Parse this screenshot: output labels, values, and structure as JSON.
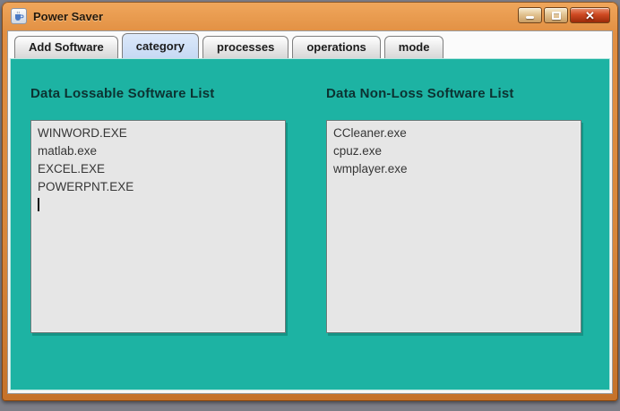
{
  "window": {
    "title": "Power Saver",
    "controls": {
      "close_glyph": "✕"
    }
  },
  "tabs": [
    {
      "label": "Add Software",
      "selected": false
    },
    {
      "label": "category",
      "selected": true
    },
    {
      "label": "processes",
      "selected": false
    },
    {
      "label": "operations",
      "selected": false
    },
    {
      "label": "mode",
      "selected": false
    }
  ],
  "panels": {
    "lossable": {
      "title": "Data Lossable Software List",
      "items": [
        "WINWORD.EXE",
        "matlab.exe",
        "EXCEL.EXE",
        "POWERPNT.EXE"
      ]
    },
    "nonloss": {
      "title": "Data Non-Loss Software List",
      "items": [
        "CCleaner.exe",
        "cpuz.exe",
        "wmplayer.exe"
      ]
    }
  },
  "colors": {
    "content_teal": "#1db3a3",
    "titlebar_orange": "#d8863a",
    "selected_tab_blue": "#c6d9f4",
    "close_button_red": "#b83312",
    "listbox_gray": "#e6e6e6"
  }
}
